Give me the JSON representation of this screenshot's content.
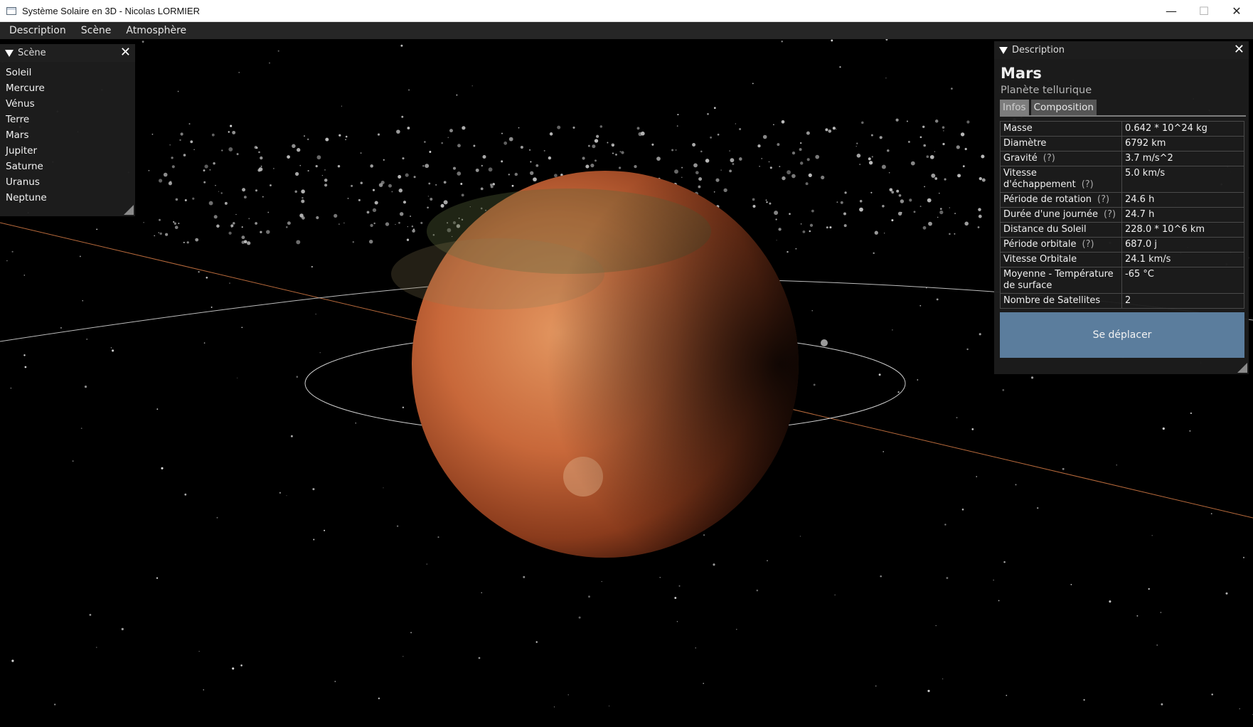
{
  "window": {
    "title": "Système Solaire en 3D - Nicolas LORMIER",
    "minimize": "—",
    "maximize": "☐",
    "close": "✕"
  },
  "menu": [
    "Description",
    "Scène",
    "Atmosphère"
  ],
  "scene_panel": {
    "title": "Scène",
    "items": [
      "Soleil",
      "Mercure",
      "Vénus",
      "Terre",
      "Mars",
      "Jupiter",
      "Saturne",
      "Uranus",
      "Neptune"
    ]
  },
  "description_panel": {
    "title": "Description",
    "name": "Mars",
    "type": "Planète tellurique",
    "tabs": [
      "Infos",
      "Composition"
    ],
    "rows": [
      {
        "label": "Masse",
        "help": "",
        "value": "0.642 * 10^24 kg"
      },
      {
        "label": "Diamètre",
        "help": "",
        "value": "6792 km"
      },
      {
        "label": "Gravité",
        "help": "(?)",
        "value": "3.7 m/s^2"
      },
      {
        "label": "Vitesse d'échappement",
        "help": "(?)",
        "value": "5.0 km/s"
      },
      {
        "label": "Période de rotation",
        "help": "(?)",
        "value": "24.6 h"
      },
      {
        "label": "Durée d'une journée",
        "help": "(?)",
        "value": "24.7 h"
      },
      {
        "label": "Distance du Soleil",
        "help": "",
        "value": "228.0 * 10^6 km"
      },
      {
        "label": "Période orbitale",
        "help": "(?)",
        "value": "687.0 j"
      },
      {
        "label": "Vitesse Orbitale",
        "help": "",
        "value": "24.1 km/s"
      },
      {
        "label": "Moyenne - Température de surface",
        "help": "",
        "value": "-65 °C"
      },
      {
        "label": "Nombre de Satellites",
        "help": "",
        "value": "2"
      }
    ],
    "move_button": "Se déplacer"
  },
  "colors": {
    "menubar": "#262626",
    "panel": "#1e1e1e",
    "button": "#5b7d9d",
    "planet": "#c0642f"
  }
}
